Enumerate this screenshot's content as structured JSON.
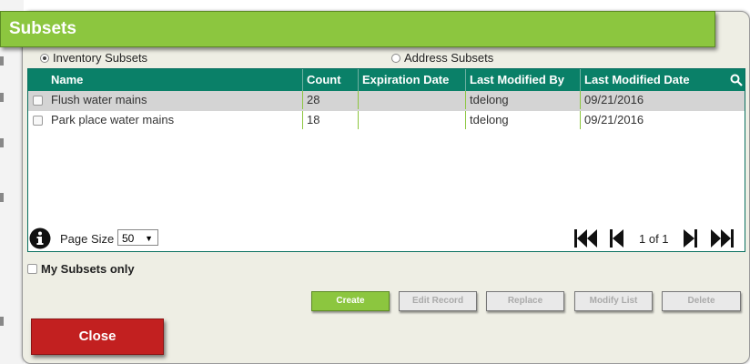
{
  "dialog": {
    "title": "Subsets"
  },
  "radios": [
    {
      "label": "Inventory Subsets",
      "selected": true
    },
    {
      "label": "Address Subsets",
      "selected": false
    }
  ],
  "grid": {
    "columns": [
      "Name",
      "Count",
      "Expiration Date",
      "Last Modified By",
      "Last Modified Date"
    ],
    "rows": [
      {
        "name": "Flush water mains",
        "count": "28",
        "expiration": "",
        "modified_by": "tdelong",
        "modified_date": "09/21/2016",
        "selected": true
      },
      {
        "name": "Park place water mains",
        "count": "18",
        "expiration": "",
        "modified_by": "tdelong",
        "modified_date": "09/21/2016",
        "selected": false
      }
    ],
    "header_color": "#0a8068"
  },
  "pager": {
    "page_size_label": "Page Size",
    "page_size_value": "50",
    "page_info": "1 of 1"
  },
  "filter": {
    "my_subsets_label": "My Subsets only"
  },
  "buttons": {
    "create": "Create",
    "edit_record": "Edit Record",
    "replace": "Replace",
    "modify_list": "Modify List",
    "delete": "Delete",
    "close": "Close"
  },
  "colors": {
    "accent": "#8cc63f",
    "close": "#c22020",
    "header": "#0a8068"
  },
  "icons": [
    "search-icon",
    "info-icon",
    "first-page-icon",
    "prev-page-icon",
    "next-page-icon",
    "last-page-icon"
  ]
}
